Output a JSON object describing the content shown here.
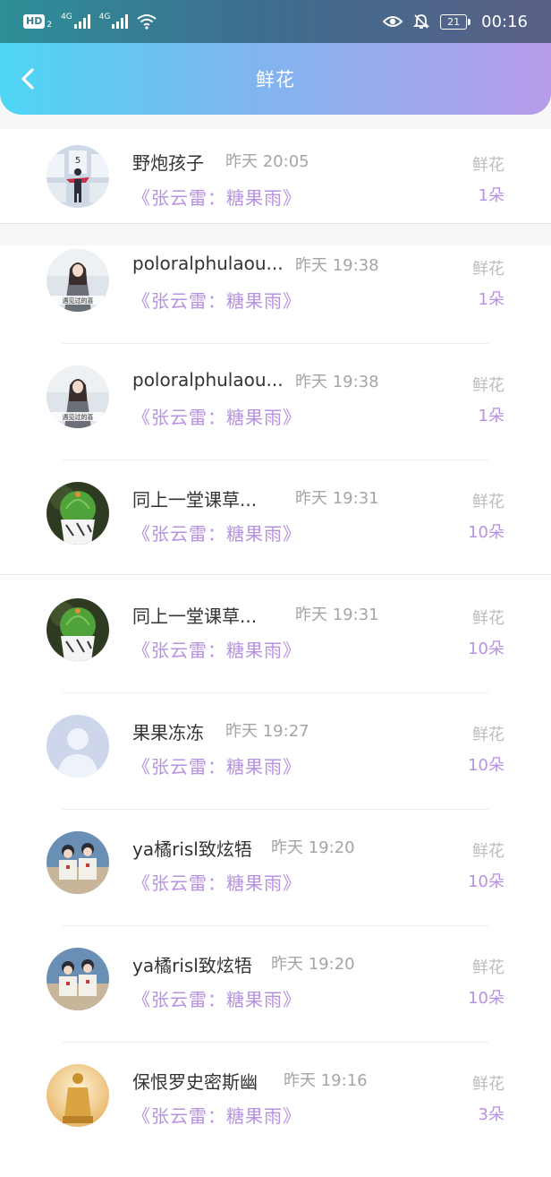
{
  "status_bar": {
    "hd": "HD",
    "hd_sub": "2",
    "net1": "4G",
    "net2": "4G",
    "battery": "21",
    "time": "00:16"
  },
  "header": {
    "title": "鲜花"
  },
  "items": [
    {
      "name": "野炮孩子",
      "time": "昨天 20:05",
      "song": "《张云雷：糖果雨》",
      "gift": "鲜花",
      "count": "1朵",
      "avatar": "avatar-figure"
    },
    {
      "name": "poloralphulaou...",
      "time": "昨天 19:38",
      "song": "《张云雷：糖果雨》",
      "gift": "鲜花",
      "count": "1朵",
      "avatar": "avatar-girl"
    },
    {
      "name": "poloralphulaou...",
      "time": "昨天 19:38",
      "song": "《张云雷：糖果雨》",
      "gift": "鲜花",
      "count": "1朵",
      "avatar": "avatar-girl"
    },
    {
      "name": "同上一堂课草...",
      "time": "昨天 19:31",
      "song": "《张云雷：糖果雨》",
      "gift": "鲜花",
      "count": "10朵",
      "avatar": "avatar-cactus"
    },
    {
      "name": "同上一堂课草...",
      "time": "昨天 19:31",
      "song": "《张云雷：糖果雨》",
      "gift": "鲜花",
      "count": "10朵",
      "avatar": "avatar-cactus"
    },
    {
      "name": "果果冻冻",
      "time": "昨天 19:27",
      "song": "《张云雷：糖果雨》",
      "gift": "鲜花",
      "count": "10朵",
      "avatar": "avatar-default"
    },
    {
      "name": "ya橘risl致炫牾",
      "time": "昨天 19:20",
      "song": "《张云雷：糖果雨》",
      "gift": "鲜花",
      "count": "10朵",
      "avatar": "avatar-couple"
    },
    {
      "name": "ya橘risl致炫牾",
      "time": "昨天 19:20",
      "song": "《张云雷：糖果雨》",
      "gift": "鲜花",
      "count": "10朵",
      "avatar": "avatar-couple"
    },
    {
      "name": "保恨罗史密斯幽",
      "time": "昨天 19:16",
      "song": "《张云雷：糖果雨》",
      "gift": "鲜花",
      "count": "3朵",
      "avatar": "avatar-statue"
    }
  ]
}
